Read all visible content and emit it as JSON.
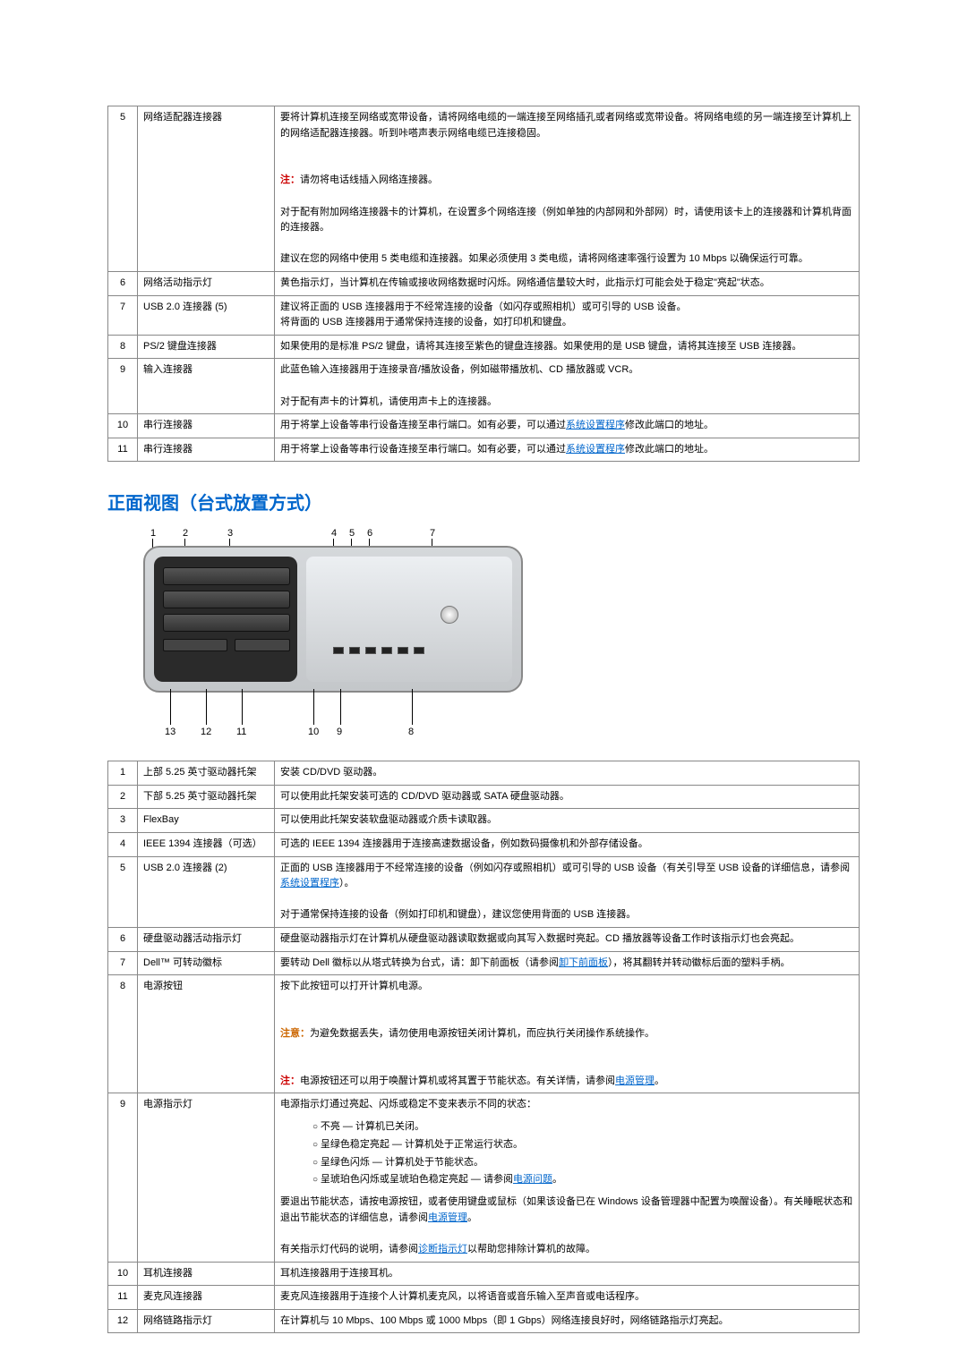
{
  "table1": [
    {
      "n": "5",
      "label": "网络适配器连接器",
      "body": "要将计算机连接至网络或宽带设备，请将网络电缆的一端连接至网络插孔或者网络或宽带设备。将网络电缆的另一端连接至计算机上的网络适配器连接器。听到咔嗒声表示网络电缆已连接稳固。",
      "note": "注：",
      "noteText": "请勿将电话线插入网络连接器。",
      "body2": "对于配有附加网络连接器卡的计算机，在设置多个网络连接（例如单独的内部网和外部网）时，请使用该卡上的连接器和计算机背面的连接器。",
      "body3": "建议在您的网络中使用 5 类电缆和连接器。如果必须使用 3 类电缆，请将网络速率强行设置为 10 Mbps 以确保运行可靠。"
    },
    {
      "n": "6",
      "label": "网络活动指示灯",
      "body": "黄色指示灯，当计算机在传输或接收网络数据时闪烁。网络通信量较大时，此指示灯可能会处于稳定\"亮起\"状态。"
    },
    {
      "n": "7",
      "label": "USB 2.0 连接器 (5)",
      "body": "建议将正面的 USB 连接器用于不经常连接的设备（如闪存或照相机）或可引导的 USB 设备。\n将背面的 USB 连接器用于通常保持连接的设备，如打印机和键盘。"
    },
    {
      "n": "8",
      "label": "PS/2 键盘连接器",
      "body": "如果使用的是标准 PS/2 键盘，请将其连接至紫色的键盘连接器。如果使用的是 USB 键盘，请将其连接至 USB 连接器。"
    },
    {
      "n": "9",
      "label": "输入连接器",
      "body": "此蓝色输入连接器用于连接录音/播放设备，例如磁带播放机、CD 播放器或 VCR。",
      "body2": "对于配有声卡的计算机，请使用声卡上的连接器。"
    },
    {
      "n": "10",
      "label": "串行连接器",
      "body": "用于将掌上设备等串行设备连接至串行端口。如有必要，可以通过",
      "link": "系统设置程序",
      "body2": "修改此端口的地址。"
    },
    {
      "n": "11",
      "label": "串行连接器",
      "body": "用于将掌上设备等串行设备连接至串行端口。如有必要，可以通过",
      "link": "系统设置程序",
      "body2": "修改此端口的地址。"
    }
  ],
  "heading": "正面视图（台式放置方式）",
  "callouts_top": [
    "1",
    "2",
    "3",
    "4",
    "5",
    "6",
    "7"
  ],
  "callouts_bot": [
    "13",
    "12",
    "11",
    "10",
    "9",
    "8"
  ],
  "table2": [
    {
      "n": "1",
      "label": "上部 5.25 英寸驱动器托架",
      "body": "安装 CD/DVD 驱动器。"
    },
    {
      "n": "2",
      "label": "下部 5.25 英寸驱动器托架",
      "body": "可以使用此托架安装可选的 CD/DVD 驱动器或 SATA 硬盘驱动器。"
    },
    {
      "n": "3",
      "label": "FlexBay",
      "body": "可以使用此托架安装软盘驱动器或介质卡读取器。"
    },
    {
      "n": "4",
      "label": "IEEE 1394 连接器（可选）",
      "body": "可选的 IEEE 1394 连接器用于连接高速数据设备，例如数码摄像机和外部存储设备。"
    },
    {
      "n": "5",
      "label": "USB 2.0 连接器 (2)",
      "body": "正面的 USB 连接器用于不经常连接的设备（例如闪存或照相机）或可引导的 USB 设备（有关引导至 USB 设备的详细信息，请参阅",
      "link": "系统设置程序",
      "body1b": "）。",
      "body2": "对于通常保持连接的设备（例如打印机和键盘），建议您使用背面的 USB 连接器。"
    },
    {
      "n": "6",
      "label": "硬盘驱动器活动指示灯",
      "body": "硬盘驱动器指示灯在计算机从硬盘驱动器读取数据或向其写入数据时亮起。CD 播放器等设备工作时该指示灯也会亮起。"
    },
    {
      "n": "7",
      "label": "Dell™ 可转动徽标",
      "body": "要转动 Dell 徽标以从塔式转换为台式，请：卸下前面板（请参阅",
      "link": "卸下前面板",
      "body1b": "），将其翻转并转动徽标后面的塑料手柄。"
    },
    {
      "n": "8",
      "label": "电源按钮",
      "body": "按下此按钮可以打开计算机电源。",
      "warnLabel": "注意：",
      "warn": "为避免数据丢失，请勿使用电源按钮关闭计算机，而应执行关闭操作系统操作。",
      "noteLabel": "注：",
      "note": "电源按钮还可以用于唤醒计算机或将其置于节能状态。有关详情，请参阅",
      "link2": "电源管理",
      "note2": "。"
    },
    {
      "n": "9",
      "label": "电源指示灯",
      "body": "电源指示灯通过亮起、闪烁或稳定不变来表示不同的状态：",
      "bullets": [
        "不亮 — 计算机已关闭。",
        "呈绿色稳定亮起 — 计算机处于正常运行状态。",
        "呈绿色闪烁 — 计算机处于节能状态。",
        "呈琥珀色闪烁或呈琥珀色稳定亮起 — 请参阅"
      ],
      "bulletLink": "电源问题",
      "bulletTail": "。",
      "body2": "要退出节能状态，请按电源按钮，或者使用键盘或鼠标（如果该设备已在 Windows 设备管理器中配置为唤醒设备）。有关睡眠状态和退出节能状态的详细信息，请参阅",
      "link": "电源管理",
      "body2b": "。",
      "body3": "有关指示灯代码的说明，请参阅",
      "link3": "诊断指示灯",
      "body3b": "以帮助您排除计算机的故障。"
    },
    {
      "n": "10",
      "label": "耳机连接器",
      "body": "耳机连接器用于连接耳机。"
    },
    {
      "n": "11",
      "label": "麦克风连接器",
      "body": "麦克风连接器用于连接个人计算机麦克风，以将语音或音乐输入至声音或电话程序。"
    },
    {
      "n": "12",
      "label": "网络链路指示灯",
      "body": "在计算机与 10 Mbps、100 Mbps 或 1000 Mbps（即 1 Gbps）网络连接良好时，网络链路指示灯亮起。"
    }
  ]
}
